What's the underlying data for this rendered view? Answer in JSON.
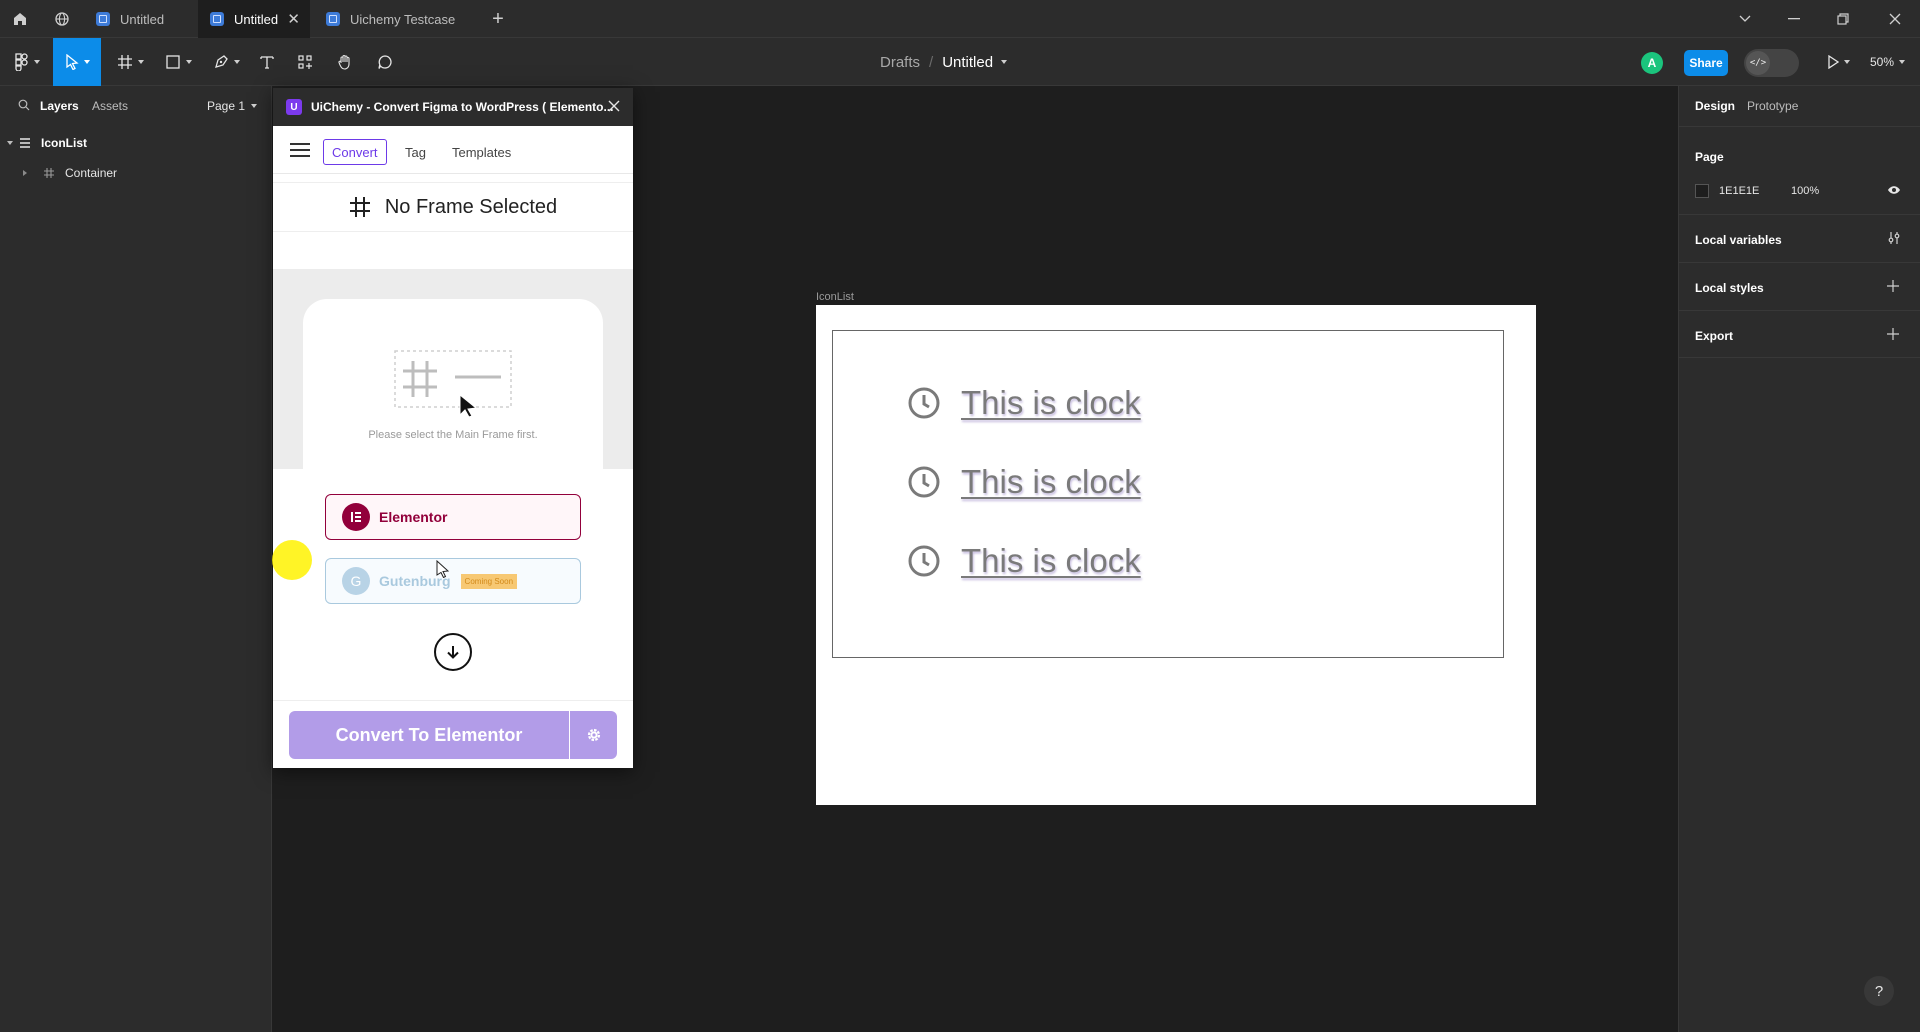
{
  "tabs": [
    {
      "label": "Untitled"
    },
    {
      "label": "Untitled"
    },
    {
      "label": "Uichemy Testcase"
    }
  ],
  "breadcrumb": {
    "parent": "Drafts",
    "separator": "/",
    "file": "Untitled"
  },
  "toolbar": {
    "avatar_initial": "A",
    "share_label": "Share",
    "zoom": "50%"
  },
  "left_panel": {
    "layers_tab": "Layers",
    "assets_tab": "Assets",
    "page_select": "Page 1",
    "layers": [
      {
        "label": "IconList"
      },
      {
        "label": "Container"
      }
    ]
  },
  "canvas": {
    "frame_label": "IconList",
    "items": [
      {
        "label": "This is clock",
        "icon": "clock-icon"
      },
      {
        "label": "This is clock",
        "icon": "clock-icon"
      },
      {
        "label": "This is clock",
        "icon": "clock-icon"
      }
    ]
  },
  "plugin": {
    "title": "UiChemy - Convert Figma to WordPress ( Elemento...",
    "nav_tabs": [
      {
        "label": "Convert"
      },
      {
        "label": "Tag"
      },
      {
        "label": "Templates"
      }
    ],
    "frame_status": "No Frame Selected",
    "hint": "Please select the Main Frame first.",
    "elementor_label": "Elementor",
    "gutenberg_label": "Gutenburg",
    "gutenberg_initial": "G",
    "coming_soon": "Coming Soon",
    "convert_label": "Convert To Elementor"
  },
  "right_panel": {
    "design_tab": "Design",
    "prototype_tab": "Prototype",
    "page_title": "Page",
    "page_color": "1E1E1E",
    "page_opacity": "100%",
    "local_variables": "Local variables",
    "local_styles": "Local styles",
    "export": "Export"
  },
  "help_label": "?",
  "colors": {
    "accent": "#0c8ce9",
    "plugin_accent": "#6d3ae8",
    "elementor": "#92003b",
    "convert_btn": "#b29ce8"
  }
}
